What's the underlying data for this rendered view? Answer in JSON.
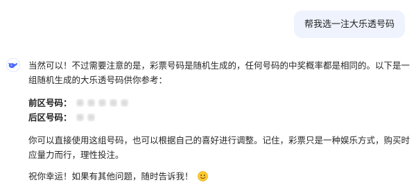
{
  "user_message": "帮我选一注大乐透号码",
  "assistant": {
    "avatar_icon": "whale-logo-icon",
    "brand_color": "#4d6bfe",
    "paragraph1": "当然可以！不过需要注意的是，彩票号码是随机生成的，任何号码的中奖概率都是相同的。以下是一组随机生成的大乐透号码供你参考：",
    "front_label": "前区号码：",
    "back_label": "后区号码：",
    "paragraph2": "你可以直接使用这组号码，也可以根据自己的喜好进行调整。记住，彩票只是一种娱乐方式，购买时应量力而行，理性投注。",
    "paragraph3": "祝你幸运！如果有其他问题，随时告诉我！",
    "end_icon": "smiling-face-emoji-icon"
  }
}
